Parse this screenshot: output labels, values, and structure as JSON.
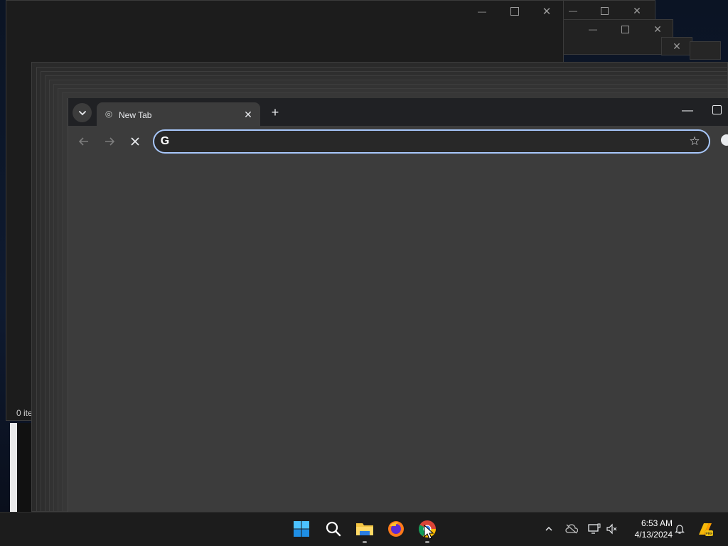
{
  "explorer": {
    "status_text": "0 ite",
    "minimize_icon": "minimize-icon",
    "maximize_icon": "maximize-icon",
    "close_icon": "close-icon"
  },
  "chrome": {
    "tab_title": "New Tab",
    "omnibox_value": "",
    "omnibox_logo": "G",
    "accent_focus": "#a8c7fa"
  },
  "taskbar": {
    "time": "6:53 AM",
    "date": "4/13/2024",
    "pinned_apps": [
      "start-icon",
      "search-icon",
      "file-explorer-icon",
      "firefox-icon",
      "chrome-icon"
    ]
  },
  "colors": {
    "chrome_frame": "#202124",
    "chrome_surface": "#3c3c3c",
    "taskbar_bg": "#1c1c1c"
  }
}
